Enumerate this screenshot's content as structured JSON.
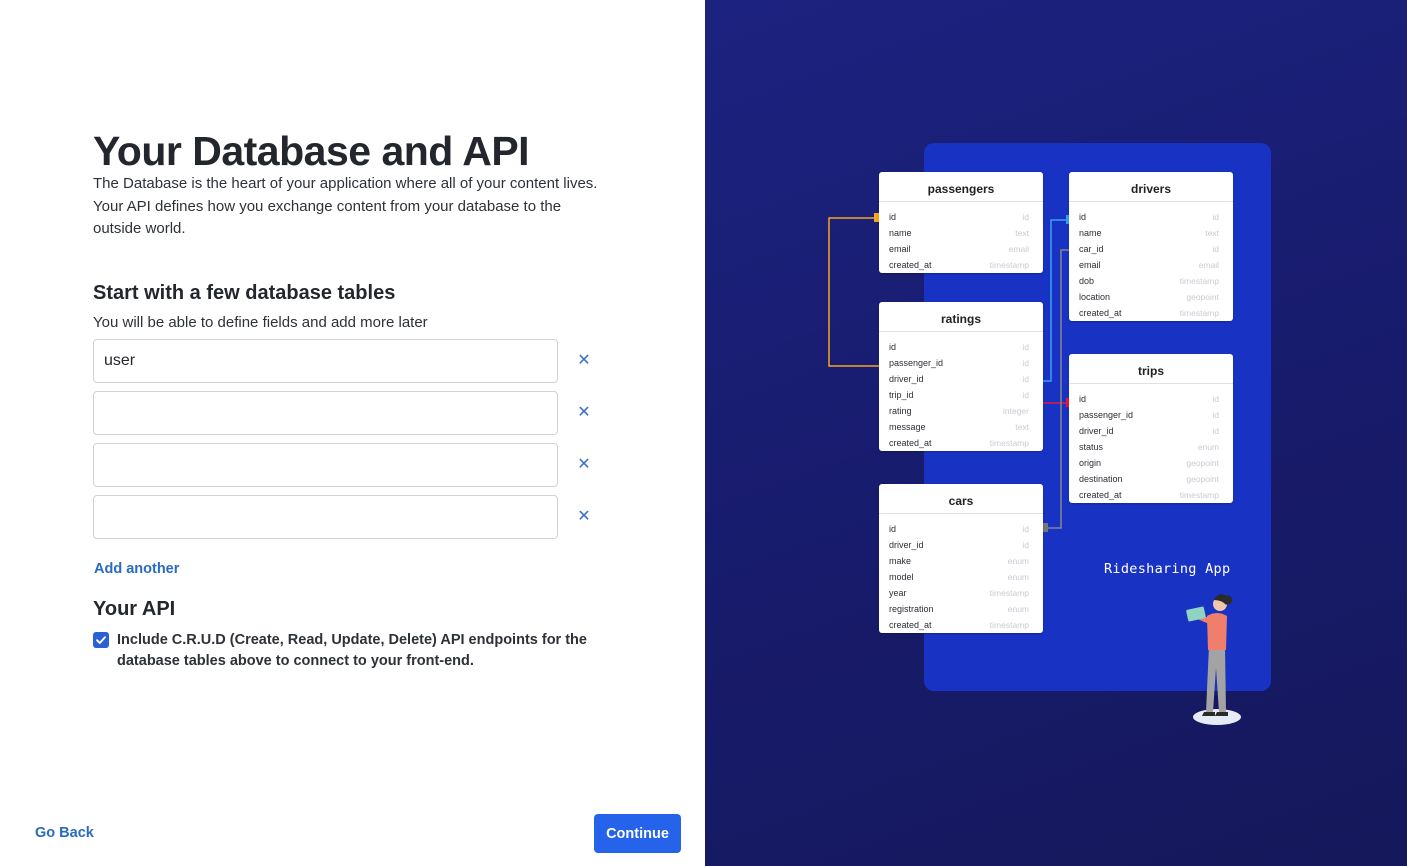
{
  "left": {
    "title": "Your Database and API",
    "intro": "The Database is the heart of your application where all of your content lives. Your API defines how you exchange content from your database to the outside world.",
    "tables_heading": "Start with a few database tables",
    "tables_sub": "You will be able to define fields and add more later",
    "inputs": [
      {
        "value": "user",
        "placeholder": ""
      },
      {
        "value": "",
        "placeholder": ""
      },
      {
        "value": "",
        "placeholder": ""
      },
      {
        "value": "",
        "placeholder": ""
      }
    ],
    "remove_glyph": "✕",
    "add_another": "Add another",
    "api_heading": "Your API",
    "crud_label": "Include C.R.U.D (Create, Read, Update, Delete) API endpoints for the database tables above to connect to your front-end.",
    "crud_checked": true,
    "go_back": "Go Back",
    "continue": "Continue",
    "accent": "#2563eb"
  },
  "diagram": {
    "app_label": "Ridesharing App",
    "tables": {
      "passengers": {
        "name": "passengers",
        "fields": [
          {
            "n": "id",
            "t": "id"
          },
          {
            "n": "name",
            "t": "text"
          },
          {
            "n": "email",
            "t": "email"
          },
          {
            "n": "created_at",
            "t": "timestamp"
          }
        ]
      },
      "drivers": {
        "name": "drivers",
        "fields": [
          {
            "n": "id",
            "t": "id"
          },
          {
            "n": "name",
            "t": "text"
          },
          {
            "n": "car_id",
            "t": "id"
          },
          {
            "n": "email",
            "t": "email"
          },
          {
            "n": "dob",
            "t": "timestamp"
          },
          {
            "n": "location",
            "t": "geopoint"
          },
          {
            "n": "created_at",
            "t": "timestamp"
          }
        ]
      },
      "ratings": {
        "name": "ratings",
        "fields": [
          {
            "n": "id",
            "t": "id"
          },
          {
            "n": "passenger_id",
            "t": "id"
          },
          {
            "n": "driver_id",
            "t": "id"
          },
          {
            "n": "trip_id",
            "t": "id"
          },
          {
            "n": "rating",
            "t": "integer"
          },
          {
            "n": "message",
            "t": "text"
          },
          {
            "n": "created_at",
            "t": "timestamp"
          }
        ]
      },
      "trips": {
        "name": "trips",
        "fields": [
          {
            "n": "id",
            "t": "id"
          },
          {
            "n": "passenger_id",
            "t": "id"
          },
          {
            "n": "driver_id",
            "t": "id"
          },
          {
            "n": "status",
            "t": "enum"
          },
          {
            "n": "origin",
            "t": "geopoint"
          },
          {
            "n": "destination",
            "t": "geopoint"
          },
          {
            "n": "created_at",
            "t": "timestamp"
          }
        ]
      },
      "cars": {
        "name": "cars",
        "fields": [
          {
            "n": "id",
            "t": "id"
          },
          {
            "n": "driver_id",
            "t": "id"
          },
          {
            "n": "make",
            "t": "enum"
          },
          {
            "n": "model",
            "t": "enum"
          },
          {
            "n": "year",
            "t": "timestamp"
          },
          {
            "n": "registration",
            "t": "enum"
          },
          {
            "n": "created_at",
            "t": "timestamp"
          }
        ]
      }
    },
    "colors": {
      "background": "#181b6b",
      "panel": "#1833c4",
      "link_orange": "#f5a623",
      "link_blue": "#3aa0f0",
      "link_red": "#e8173c",
      "link_gray": "#888888"
    }
  }
}
